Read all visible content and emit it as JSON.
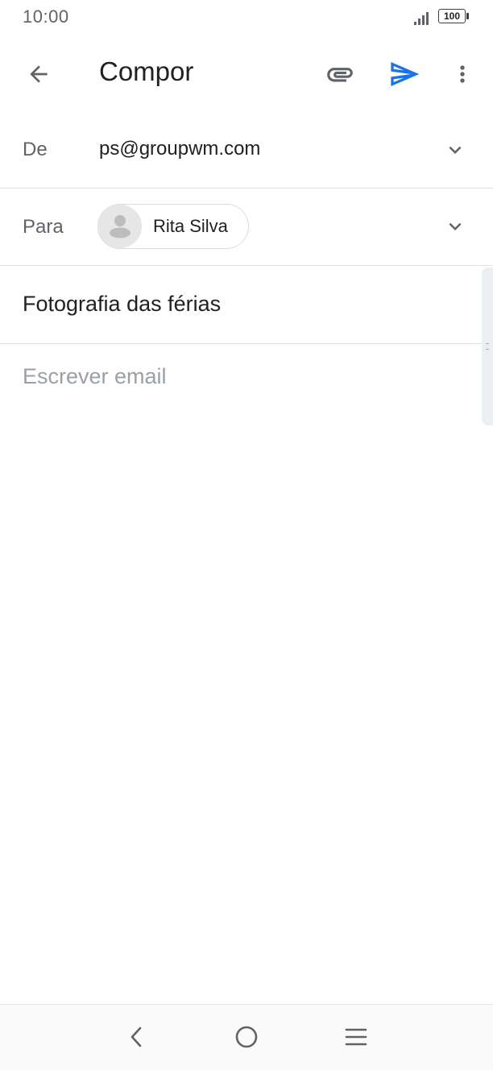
{
  "status_bar": {
    "time": "10:00",
    "battery_level": "100",
    "icons": [
      "signal-icon",
      "battery-icon"
    ]
  },
  "app_bar": {
    "title": "Compor",
    "icons": [
      "back-arrow-icon",
      "paperclip-icon",
      "send-icon",
      "more-vert-icon"
    ],
    "send_color": "#1a73e8"
  },
  "compose": {
    "from_label": "De",
    "from_value": "ps@groupwm.com",
    "to_label": "Para",
    "recipients": [
      {
        "name": "Rita Silva",
        "icon": "person-avatar-icon"
      }
    ],
    "subject": "Fotografia das férias",
    "body_placeholder": "Escrever email",
    "body_value": ""
  },
  "nav_bar": {
    "icons": [
      "nav-back-icon",
      "nav-home-icon",
      "nav-menu-icon"
    ]
  }
}
